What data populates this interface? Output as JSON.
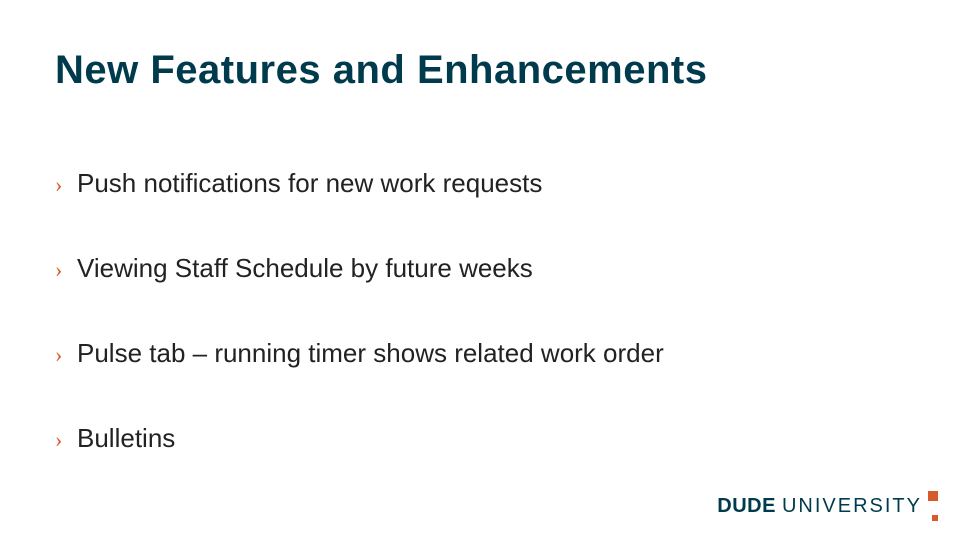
{
  "title": "New Features and Enhancements",
  "bullets": [
    "Push notifications for new work requests",
    "Viewing Staff Schedule by future weeks",
    "Pulse tab – running timer shows related work order",
    "Bulletins"
  ],
  "bullet_glyph": "›",
  "logo": {
    "brand": "DUDE",
    "sub": "UNIVERSITY"
  },
  "colors": {
    "heading": "#003b4d",
    "accent": "#d85a2a",
    "body": "#222222"
  }
}
